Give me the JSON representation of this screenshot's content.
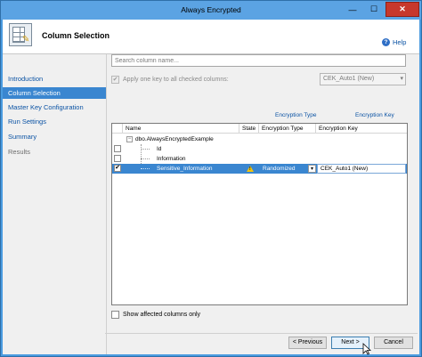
{
  "window": {
    "title": "Always Encrypted",
    "min_glyph": "—",
    "max_glyph": "☐",
    "close_glyph": "✕"
  },
  "header": {
    "title": "Column Selection"
  },
  "sidebar": {
    "items": [
      {
        "label": "Introduction"
      },
      {
        "label": "Column Selection"
      },
      {
        "label": "Master Key Configuration"
      },
      {
        "label": "Run Settings"
      },
      {
        "label": "Summary"
      },
      {
        "label": "Results"
      }
    ]
  },
  "help": {
    "label": "Help",
    "icon_glyph": "?"
  },
  "search": {
    "placeholder": "Search column name...",
    "value": ""
  },
  "apply_one_key": {
    "label": "Apply one key to all checked columns:",
    "checked": true,
    "selected_key": "CEK_Auto1 (New)"
  },
  "column_links": {
    "encryption_type": "Encryption Type",
    "encryption_key": "Encryption Key"
  },
  "grid": {
    "headers": {
      "name": "Name",
      "state": "State",
      "encryption_type": "Encryption Type",
      "encryption_key": "Encryption Key"
    },
    "table": {
      "name": "dbo.AlwaysEncryptedExample",
      "expander": "−"
    },
    "rows": [
      {
        "name": "Id",
        "checked": false,
        "state": "",
        "encryption_type": "",
        "encryption_key": ""
      },
      {
        "name": "Information",
        "checked": false,
        "state": "",
        "encryption_type": "",
        "encryption_key": ""
      },
      {
        "name": "Sensitive_Information",
        "checked": true,
        "check_glyph": "✔",
        "state": "warning",
        "encryption_type": "Randomized",
        "encryption_key": "CEK_Auto1 (New)"
      }
    ]
  },
  "show_affected": {
    "label": "Show affected columns only",
    "checked": false
  },
  "buttons": {
    "previous": "< Previous",
    "next": "Next >",
    "cancel": "Cancel"
  },
  "dropdown_arrow": "▾",
  "colors": {
    "accent": "#3a86d0",
    "link": "#0b53a4",
    "window": "#5ba3e3",
    "close": "#c7382c"
  }
}
